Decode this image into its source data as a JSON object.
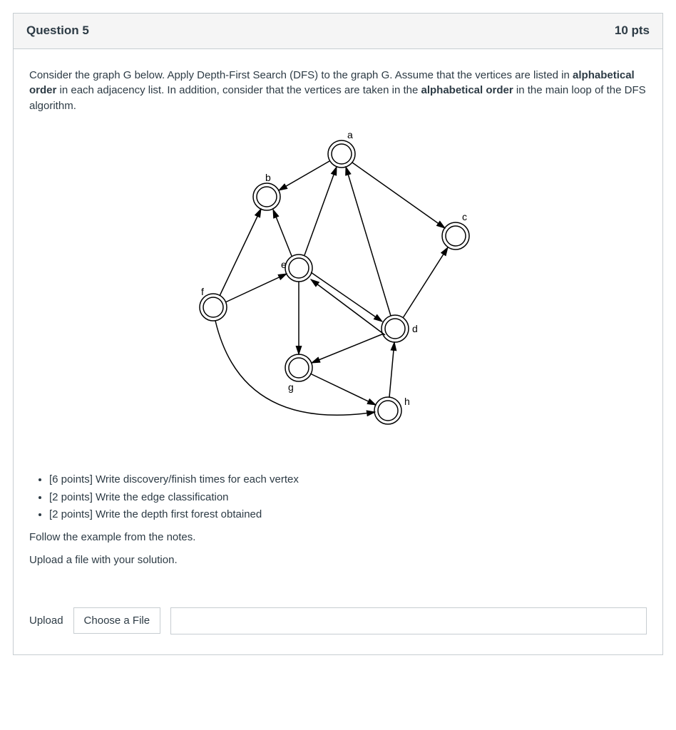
{
  "header": {
    "title": "Question 5",
    "points": "10 pts"
  },
  "prompt": {
    "line1_a": "Consider the graph G below. Apply Depth-First Search (DFS) to the graph G. Assume that the vertices are listed in ",
    "line1_b": "alphabetical order",
    "line1_c": " in each adjacency list. In addition, consider that the vertices are taken in the ",
    "line1_d": "alphabetical order",
    "line1_e": " in the main loop of the DFS algorithm."
  },
  "graph": {
    "node_labels": {
      "a": "a",
      "b": "b",
      "c": "c",
      "d": "d",
      "e": "e",
      "f": "f",
      "g": "g",
      "h": "h"
    }
  },
  "tasks": [
    "[6 points] Write discovery/finish times for each vertex",
    "[2 points] Write the edge classification",
    "[2 points] Write the depth first forest obtained"
  ],
  "followText": "Follow the example from the notes.",
  "uploadNote": "Upload a file with your solution.",
  "upload": {
    "label": "Upload",
    "button": "Choose a File"
  }
}
